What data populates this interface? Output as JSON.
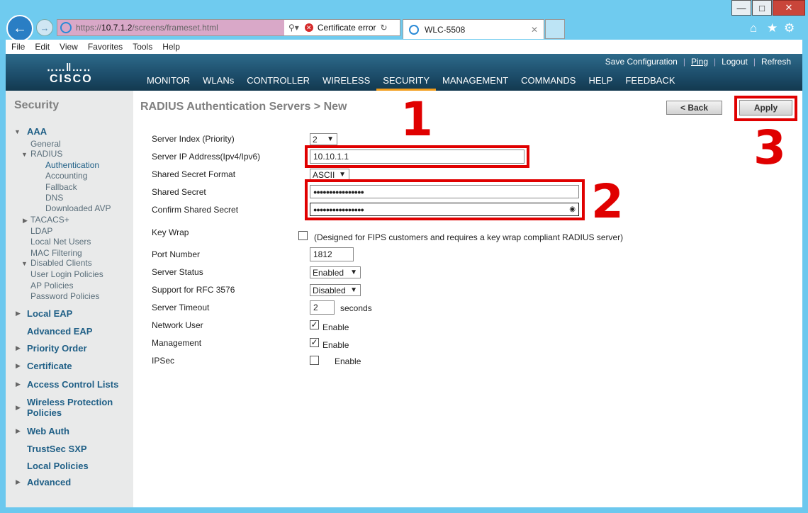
{
  "browser": {
    "url_prefix": "https://",
    "url_host": "10.7.1.2",
    "url_path": "/screens/frameset.html",
    "cert_error": "Certificate error",
    "tab_title": "WLC-5508",
    "menu": [
      "File",
      "Edit",
      "View",
      "Favorites",
      "Tools",
      "Help"
    ]
  },
  "header": {
    "logo": "CISCO",
    "top_links": [
      "Save Configuration",
      "Ping",
      "Logout",
      "Refresh"
    ],
    "nav": [
      "MONITOR",
      "WLANs",
      "CONTROLLER",
      "WIRELESS",
      "SECURITY",
      "MANAGEMENT",
      "COMMANDS",
      "HELP",
      "FEEDBACK"
    ],
    "active_nav": "SECURITY"
  },
  "sidebar": {
    "title": "Security",
    "aaa": "AAA",
    "general": "General",
    "radius": "RADIUS",
    "authentication": "Authentication",
    "accounting": "Accounting",
    "fallback": "Fallback",
    "dns": "DNS",
    "downloaded_avp": "Downloaded AVP",
    "tacacs": "TACACS+",
    "ldap": "LDAP",
    "local_net_users": "Local Net Users",
    "mac_filtering": "MAC Filtering",
    "disabled_clients": "Disabled Clients",
    "user_login_policies": "User Login Policies",
    "ap_policies": "AP Policies",
    "password_policies": "Password Policies",
    "local_eap": "Local EAP",
    "advanced_eap": "Advanced EAP",
    "priority_order": "Priority Order",
    "certificate": "Certificate",
    "acl": "Access Control Lists",
    "wips_1": "Wireless Protection",
    "wips_2": "Policies",
    "web_auth": "Web Auth",
    "trustsec": "TrustSec SXP",
    "local_policies": "Local Policies",
    "advanced": "Advanced"
  },
  "page": {
    "title": "RADIUS Authentication Servers > New",
    "back": "< Back",
    "apply": "Apply"
  },
  "form": {
    "server_index_label": "Server Index (Priority)",
    "server_index": "2",
    "server_ip_label": "Server IP Address(Ipv4/Ipv6)",
    "server_ip": "10.10.1.1",
    "secret_format_label": "Shared Secret Format",
    "secret_format": "ASCII",
    "secret_label": "Shared Secret",
    "secret": "●●●●●●●●●●●●●●●●",
    "confirm_label": "Confirm Shared Secret",
    "confirm": "●●●●●●●●●●●●●●●●",
    "key_wrap_label": "Key Wrap",
    "key_wrap_note": "(Designed for FIPS customers and requires a key wrap compliant RADIUS server)",
    "port_label": "Port Number",
    "port": "1812",
    "status_label": "Server Status",
    "status": "Enabled",
    "rfc_label": "Support for RFC 3576",
    "rfc": "Disabled",
    "timeout_label": "Server Timeout",
    "timeout": "2",
    "timeout_unit": "seconds",
    "network_user_label": "Network User",
    "network_user_enable": "Enable",
    "mgmt_label": "Management",
    "mgmt_enable": "Enable",
    "ipsec_label": "IPSec",
    "ipsec_enable": "Enable"
  },
  "annotations": {
    "n1": "1",
    "n2": "2",
    "n3": "3",
    "color": "#e00000"
  }
}
